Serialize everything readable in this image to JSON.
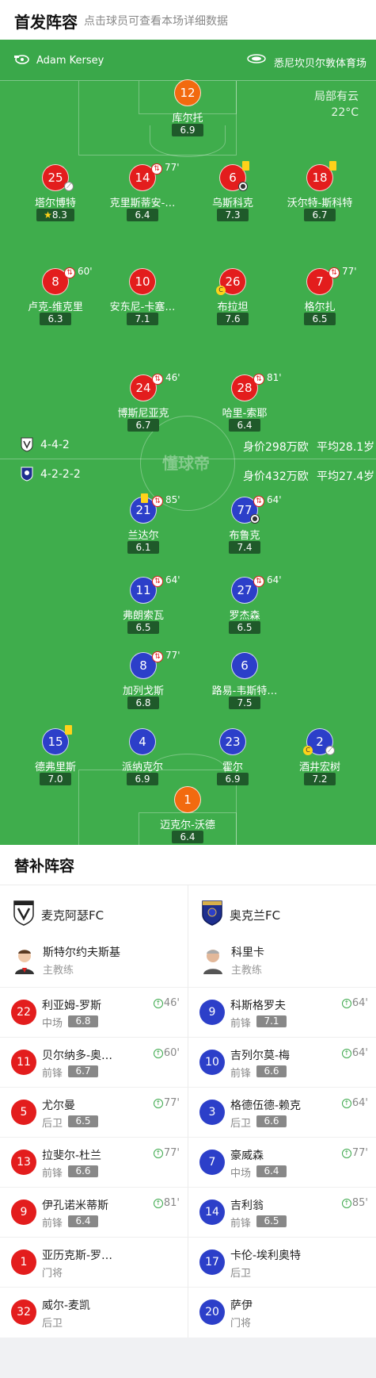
{
  "header": {
    "title": "首发阵容",
    "subtitle": "点击球员可查看本场详细数据"
  },
  "pitch": {
    "referee": "Adam Kersey",
    "stadium": "悉尼坎贝尔敦体育场",
    "weather": "局部有云",
    "temperature": "22°C",
    "watermark": "懂球帝"
  },
  "home_team_bar": {
    "formation": "4-4-2",
    "value": "身价298万欧",
    "avg_age": "平均28.1岁"
  },
  "away_team_bar": {
    "formation": "4-2-2-2",
    "value": "身价432万欧",
    "avg_age": "平均27.4岁"
  },
  "home_players": [
    {
      "num": "12",
      "name": "库尔托",
      "rating": "6.9"
    },
    {
      "num": "25",
      "name": "塔尔博特",
      "rating": "8.3"
    },
    {
      "num": "14",
      "name": "克里斯蒂安-…",
      "rating": "6.4",
      "sub": "77'"
    },
    {
      "num": "6",
      "name": "乌斯科克",
      "rating": "7.3"
    },
    {
      "num": "18",
      "name": "沃尔特-斯科特",
      "rating": "6.7"
    },
    {
      "num": "8",
      "name": "卢克-维克里",
      "rating": "6.3",
      "sub": "60'"
    },
    {
      "num": "10",
      "name": "安东尼-卡塞…",
      "rating": "7.1"
    },
    {
      "num": "26",
      "name": "布拉坦",
      "rating": "7.6"
    },
    {
      "num": "7",
      "name": "格尔扎",
      "rating": "6.5",
      "sub": "77'"
    },
    {
      "num": "24",
      "name": "博斯尼亚克",
      "rating": "6.7",
      "sub": "46'"
    },
    {
      "num": "28",
      "name": "哈里-索耶",
      "rating": "6.4",
      "sub": "81'"
    }
  ],
  "away_players": [
    {
      "num": "21",
      "name": "兰达尔",
      "rating": "6.1",
      "sub": "85'"
    },
    {
      "num": "77",
      "name": "布鲁克",
      "rating": "7.4",
      "sub": "64'"
    },
    {
      "num": "11",
      "name": "弗朗索瓦",
      "rating": "6.5",
      "sub": "64'"
    },
    {
      "num": "27",
      "name": "罗杰森",
      "rating": "6.5",
      "sub": "64'"
    },
    {
      "num": "8",
      "name": "加列戈斯",
      "rating": "6.8",
      "sub": "77'"
    },
    {
      "num": "6",
      "name": "路易-韦斯特…",
      "rating": "7.5"
    },
    {
      "num": "15",
      "name": "德弗里斯",
      "rating": "7.0"
    },
    {
      "num": "4",
      "name": "派纳克尔",
      "rating": "6.9"
    },
    {
      "num": "23",
      "name": "霍尔",
      "rating": "6.9"
    },
    {
      "num": "2",
      "name": "酒井宏树",
      "rating": "7.2"
    },
    {
      "num": "1",
      "name": "迈克尔-沃德",
      "rating": "6.4"
    }
  ],
  "subs": {
    "title": "替补阵容",
    "home": {
      "team_name": "麦克阿瑟FC",
      "coach_name": "斯特尔约夫斯基",
      "coach_role": "主教练",
      "players": [
        {
          "num": "22",
          "name": "利亚姆-罗斯",
          "pos": "中场",
          "rating": "6.8",
          "sub_in": "46'"
        },
        {
          "num": "11",
          "name": "贝尔纳多-奥…",
          "pos": "前锋",
          "rating": "6.7",
          "sub_in": "60'"
        },
        {
          "num": "5",
          "name": "尤尔曼",
          "pos": "后卫",
          "rating": "6.5",
          "sub_in": "77'"
        },
        {
          "num": "13",
          "name": "拉斐尔-杜兰",
          "pos": "前锋",
          "rating": "6.6",
          "sub_in": "77'"
        },
        {
          "num": "9",
          "name": "伊孔诺米蒂斯",
          "pos": "前锋",
          "rating": "6.4",
          "sub_in": "81'"
        },
        {
          "num": "1",
          "name": "亚历克斯-罗…",
          "pos": "门将"
        },
        {
          "num": "32",
          "name": "威尔-麦凯",
          "pos": "后卫"
        }
      ]
    },
    "away": {
      "team_name": "奥克兰FC",
      "coach_name": "科里卡",
      "coach_role": "主教练",
      "players": [
        {
          "num": "9",
          "name": "科斯格罗夫",
          "pos": "前锋",
          "rating": "7.1",
          "sub_in": "64'"
        },
        {
          "num": "10",
          "name": "吉列尔莫-梅",
          "pos": "前锋",
          "rating": "6.6",
          "sub_in": "64'"
        },
        {
          "num": "3",
          "name": "格德伍德-赖克",
          "pos": "后卫",
          "rating": "6.6",
          "sub_in": "64'"
        },
        {
          "num": "7",
          "name": "豪威森",
          "pos": "中场",
          "rating": "6.4",
          "sub_in": "77'"
        },
        {
          "num": "14",
          "name": "吉利翁",
          "pos": "前锋",
          "rating": "6.5",
          "sub_in": "85'"
        },
        {
          "num": "17",
          "name": "卡伦-埃利奥特",
          "pos": "后卫"
        },
        {
          "num": "20",
          "name": "萨伊",
          "pos": "门将"
        }
      ]
    }
  },
  "colors": {
    "home": "#e31d1d",
    "goalkeeper": "#f26a0f",
    "away": "#2c3fc9",
    "pitch": "#3fad4c"
  },
  "icons": [
    "whistle-icon",
    "stadium-icon",
    "substitution-icon",
    "yellow-card-icon",
    "ball-icon",
    "captain-icon",
    "star-icon"
  ]
}
